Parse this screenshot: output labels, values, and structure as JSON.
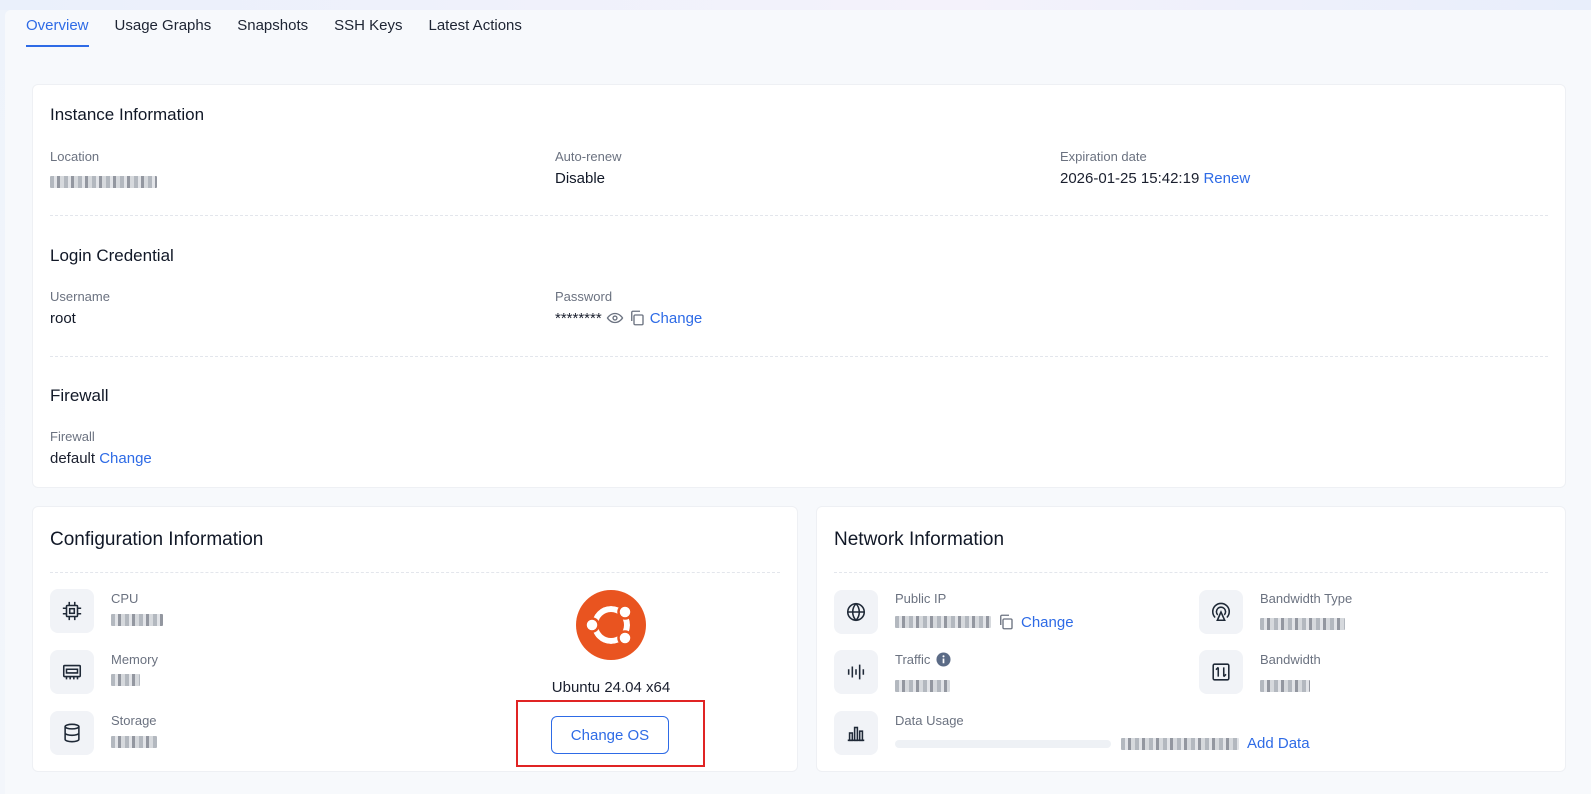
{
  "tabs": [
    "Overview",
    "Usage Graphs",
    "Snapshots",
    "SSH Keys",
    "Latest Actions"
  ],
  "instance": {
    "title": "Instance Information",
    "location_label": "Location",
    "autorenew_label": "Auto-renew",
    "autorenew_value": "Disable",
    "expiration_label": "Expiration date",
    "expiration_value": "2026-01-25 15:42:19",
    "renew_link": "Renew"
  },
  "login": {
    "title": "Login Credential",
    "username_label": "Username",
    "username_value": "root",
    "password_label": "Password",
    "password_value": "********",
    "change_link": "Change"
  },
  "firewall": {
    "title": "Firewall",
    "label": "Firewall",
    "value": "default",
    "change_link": "Change"
  },
  "config": {
    "title": "Configuration Information",
    "cpu_label": "CPU",
    "memory_label": "Memory",
    "storage_label": "Storage",
    "os_name": "Ubuntu 24.04 x64",
    "change_os": "Change OS",
    "os_color": "#e95420"
  },
  "network": {
    "title": "Network Information",
    "public_ip_label": "Public IP",
    "ip_change_link": "Change",
    "bandwidth_type_label": "Bandwidth Type",
    "traffic_label": "Traffic",
    "bandwidth_label": "Bandwidth",
    "data_usage_label": "Data Usage",
    "data_usage_fraction": 0,
    "add_data_link": "Add Data"
  },
  "colors": {
    "accent": "#2e6be6",
    "highlight": "#e02424"
  }
}
